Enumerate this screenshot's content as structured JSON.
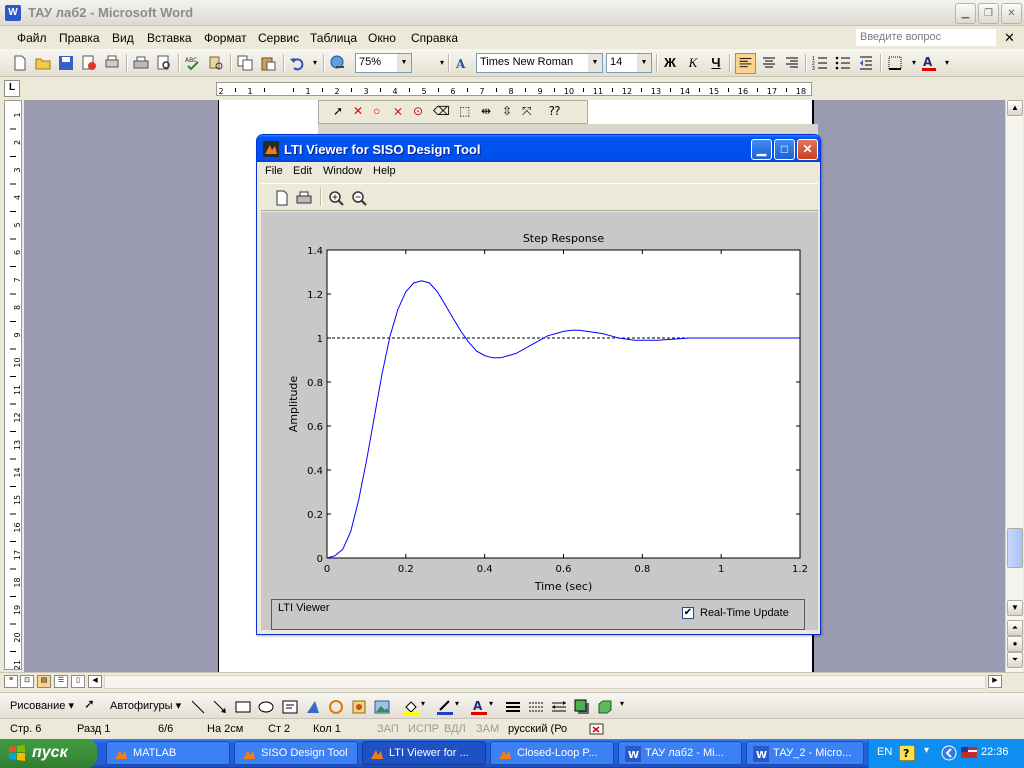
{
  "word": {
    "title": "ТАУ лаб2 - Microsoft Word",
    "menu": [
      "Файл",
      "Правка",
      "Вид",
      "Вставка",
      "Формат",
      "Сервис",
      "Таблица",
      "Окно",
      "Справка"
    ],
    "help_placeholder": "Введите вопрос",
    "zoom": "75%",
    "font_name": "Times New Roman",
    "font_size": "14",
    "bold": "Ж",
    "italic": "К",
    "underline": "Ч",
    "drawing_label": "Рисование ▾",
    "autoshapes_label": "Автофигуры ▾"
  },
  "status": {
    "page": "Стр.  6",
    "section": "Разд  1",
    "pages": "6/6",
    "at": "На  2см",
    "line": "Ст  2",
    "col": "Кол  1",
    "rec": "ЗАП",
    "trk": "ИСПР",
    "ext": "ВДЛ",
    "ovr": "ЗАМ",
    "lang": "русский (Ро"
  },
  "lti": {
    "title": "LTI Viewer for SISO Design Tool",
    "menu": [
      "File",
      "Edit",
      "Window",
      "Help"
    ],
    "status_text": "LTI Viewer",
    "realtime_label": "Real-Time Update",
    "realtime_checked": true
  },
  "chart_data": {
    "type": "line",
    "title": "Step Response",
    "xlabel": "Time (sec)",
    "ylabel": "Amplitude",
    "xlim": [
      0,
      1.2
    ],
    "ylim": [
      0,
      1.4
    ],
    "xticks": [
      "0",
      "0.2",
      "0.4",
      "0.6",
      "0.8",
      "1",
      "1.2"
    ],
    "yticks": [
      "0",
      "0.2",
      "0.4",
      "0.6",
      "0.8",
      "1",
      "1.2",
      "1.4"
    ],
    "reference_line": 1,
    "series": [
      {
        "color": "#0000ff",
        "x": [
          0,
          0.02,
          0.04,
          0.06,
          0.08,
          0.1,
          0.12,
          0.14,
          0.16,
          0.18,
          0.2,
          0.22,
          0.24,
          0.26,
          0.28,
          0.3,
          0.32,
          0.34,
          0.36,
          0.38,
          0.4,
          0.42,
          0.44,
          0.46,
          0.48,
          0.5,
          0.52,
          0.54,
          0.56,
          0.58,
          0.6,
          0.62,
          0.64,
          0.66,
          0.68,
          0.7,
          0.72,
          0.74,
          0.76,
          0.78,
          0.8,
          0.84,
          0.88,
          0.92,
          0.96,
          1.0,
          1.05,
          1.1,
          1.15,
          1.2
        ],
        "y": [
          0,
          0.01,
          0.04,
          0.12,
          0.26,
          0.44,
          0.64,
          0.84,
          1.01,
          1.13,
          1.21,
          1.25,
          1.26,
          1.25,
          1.21,
          1.15,
          1.09,
          1.03,
          0.98,
          0.94,
          0.92,
          0.91,
          0.91,
          0.92,
          0.93,
          0.95,
          0.97,
          0.99,
          1.01,
          1.02,
          1.03,
          1.035,
          1.035,
          1.03,
          1.025,
          1.02,
          1.01,
          1.0,
          0.995,
          0.99,
          0.99,
          0.99,
          0.995,
          1.0,
          1.0,
          1.0,
          1.0,
          1.0,
          1.0,
          1.0
        ]
      }
    ]
  },
  "taskbar": {
    "start_label": "пуск",
    "tasks": [
      "MATLAB",
      "SISO Design Tool",
      "LTI Viewer for ...",
      "Closed-Loop P...",
      "ТАУ лаб2 - Mi...",
      "ТАУ_2 - Micro..."
    ],
    "lang": "EN",
    "clock": "22:36"
  },
  "colors": {
    "xp_blue": "#0053ee",
    "plot_line": "#0000ff",
    "doc_background": "#9a9ab0"
  }
}
